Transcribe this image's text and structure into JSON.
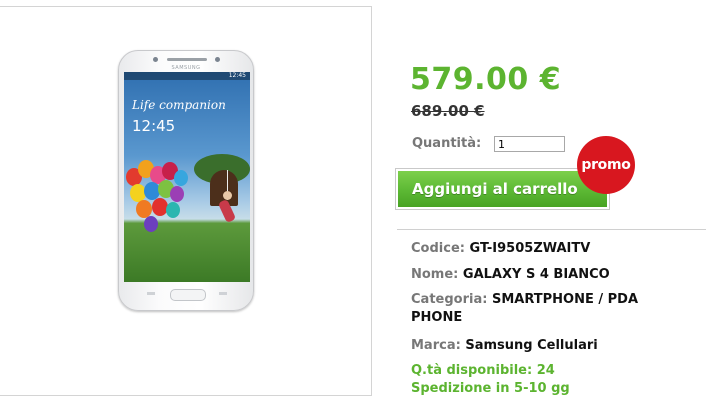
{
  "product_image": {
    "brand_text": "SAMSUNG",
    "status_time": "12:45",
    "tagline": "Life companion",
    "clock": "12:45"
  },
  "pricing": {
    "current_price": "579.00 €",
    "old_price": "689.00 €"
  },
  "quantity": {
    "label": "Quantità:",
    "value": "1"
  },
  "cart": {
    "button_label": "Aggiungi al carrello",
    "promo_badge": "promo"
  },
  "details": {
    "code_label": "Codice:",
    "code_value": "GT-I9505ZWAITV",
    "name_label": "Nome:",
    "name_value": "GALAXY S 4 BIANCO",
    "category_label": "Categoria:",
    "category_value": "SMARTPHONE / PDA",
    "category_value_2": "PHONE",
    "brand_label": "Marca:",
    "brand_value": "Samsung Cellulari"
  },
  "availability": {
    "stock": "Q.tà disponibile: 24",
    "shipping": "Spedizione in 5-10 gg"
  },
  "colors": {
    "price_green": "#5cb430",
    "promo_red": "#d8171f",
    "button_green": "#5cb834"
  }
}
